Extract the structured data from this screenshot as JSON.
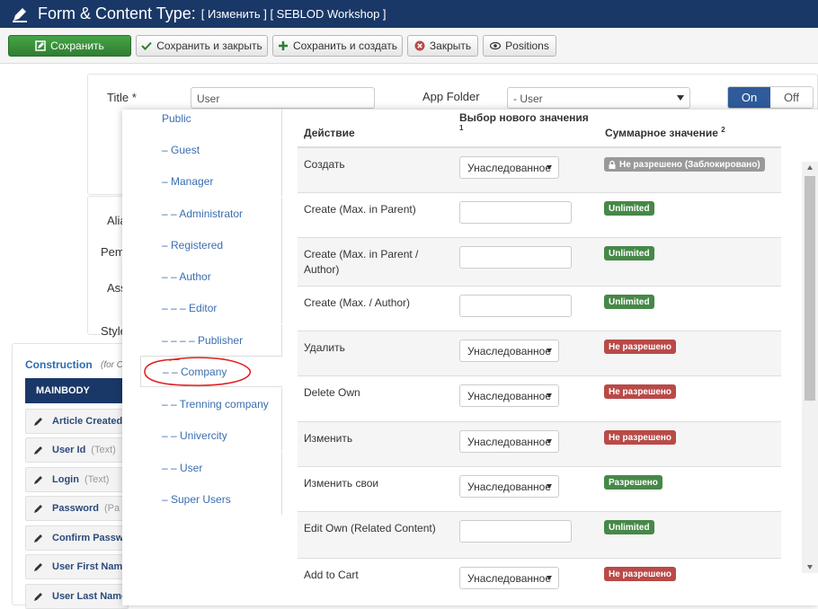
{
  "header": {
    "title": "Form & Content Type:",
    "subtitle": "[ Изменить ] [ SEBLOD Workshop ]",
    "icon": "pencil-icon"
  },
  "toolbar": {
    "save": "Сохранить",
    "save_close": "Сохранить и закрыть",
    "save_new": "Сохранить и создать",
    "close": "Закрыть",
    "positions": "Positions"
  },
  "form": {
    "title_label": "Title *",
    "title_value": "User",
    "app_folder_label": "App Folder",
    "app_folder_value": "- User",
    "toggle_on": "On",
    "toggle_off": "Off",
    "partial_labels": [
      "Alia",
      "Pem",
      "Ass",
      "Style"
    ]
  },
  "construction": {
    "title": "Construction",
    "subtitle": "(for C",
    "mainbody": "MAINBODY",
    "fields": [
      {
        "label": "Article Created",
        "type": ""
      },
      {
        "label": "User Id",
        "type": "(Text)"
      },
      {
        "label": "Login",
        "type": "(Text)"
      },
      {
        "label": "Password",
        "type": "(Pa"
      },
      {
        "label": "Confirm Passw",
        "type": ""
      },
      {
        "label": "User First Name",
        "type": ""
      },
      {
        "label": "User Last Name",
        "type": ""
      }
    ]
  },
  "groups": [
    "Public",
    "– Guest",
    "– Manager",
    "– – Administrator",
    "– Registered",
    "– – Author",
    "– – – Editor",
    "– – – – Publisher",
    "– – Company",
    "– – Trenning company",
    "– – Univercity",
    "– – User",
    "– Super Users"
  ],
  "permissions": {
    "col_action": "Действие",
    "col_new": "Выбор нового значения",
    "col_new_sup": "1",
    "col_sum": "Суммарное значение",
    "col_sum_sup": "2",
    "rows": [
      {
        "action": "Создать",
        "control": "select",
        "value": "Унаследованное",
        "badge": "Не разрешено (Заблокировано)",
        "badge_type": "locked"
      },
      {
        "action": "Create (Max. in Parent)",
        "control": "text",
        "value": "",
        "badge": "Unlimited",
        "badge_type": "unlimited"
      },
      {
        "action": "Create (Max. in Parent / Author)",
        "control": "text",
        "value": "",
        "badge": "Unlimited",
        "badge_type": "unlimited"
      },
      {
        "action": "Create (Max. / Author)",
        "control": "text",
        "value": "",
        "badge": "Unlimited",
        "badge_type": "unlimited"
      },
      {
        "action": "Удалить",
        "control": "select",
        "value": "Унаследованное",
        "badge": "Не разрешено",
        "badge_type": "denied"
      },
      {
        "action": "Delete Own",
        "control": "select",
        "value": "Унаследованное",
        "badge": "Не разрешено",
        "badge_type": "denied"
      },
      {
        "action": "Изменить",
        "control": "select",
        "value": "Унаследованное",
        "badge": "Не разрешено",
        "badge_type": "denied"
      },
      {
        "action": "Изменить свои",
        "control": "select",
        "value": "Унаследованное",
        "badge": "Разрешено",
        "badge_type": "allowed"
      },
      {
        "action": "Edit Own (Related Content)",
        "control": "text",
        "value": "",
        "badge": "Unlimited",
        "badge_type": "unlimited"
      },
      {
        "action": "Add to Cart",
        "control": "select",
        "value": "Унаследованное",
        "badge": "Не разрешено",
        "badge_type": "denied"
      }
    ]
  },
  "colors": {
    "header_bg": "#1a3867",
    "save_green": "#46a546",
    "denied_red": "#b94a48",
    "allowed_green": "#468847",
    "locked_gray": "#999999",
    "link_blue": "#3a6eb0",
    "annotation_red": "#e21b1b"
  }
}
